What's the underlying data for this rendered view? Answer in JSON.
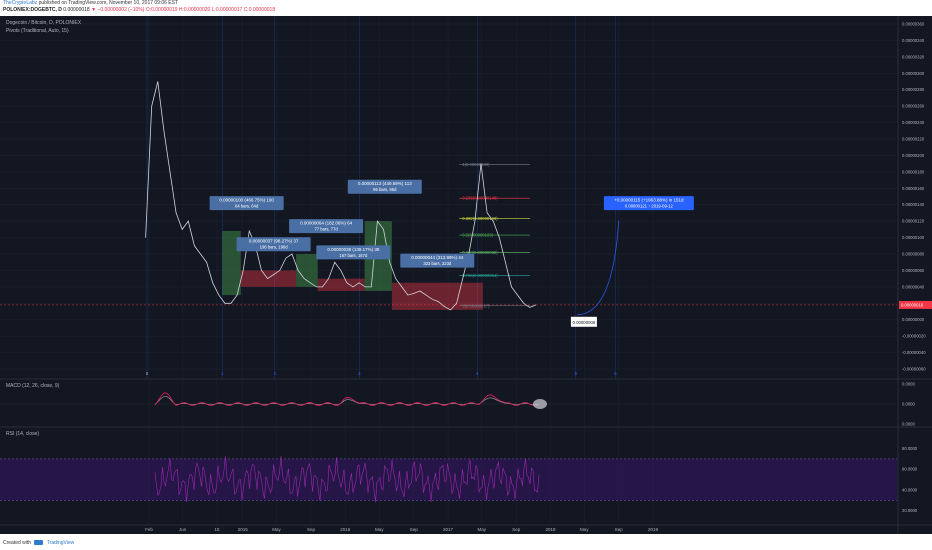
{
  "header": {
    "publisher": "TheCryptoLabz",
    "published_text": "published on TradingView.com, November 10, 2017 09:06 EST",
    "symbol_line": "POLONIEX:DOGEBTC, D",
    "price": "0.00000018",
    "change": "−0.00000002 (−10%)",
    "ohlc": "O:0.00000019 H:0.00000020 L:0.00000017 C:0.00000018"
  },
  "footer": {
    "created_with": "Created with",
    "brand": "TradingView"
  },
  "chart_data": [
    {
      "type": "line",
      "title": "Dogecoin / Bitcoin, D, POLONIEX",
      "subtitle": "Pivots (Traditional, Auto, 15)",
      "x": [
        "Feb",
        "Jun",
        "15",
        "2015",
        "May",
        "Sep",
        "2016",
        "May",
        "Sep",
        "2017",
        "May",
        "Sep",
        "2018",
        "May",
        "Sep",
        "2019"
      ],
      "y_ticks": [
        "0.00000360",
        "0.00000340",
        "0.00000320",
        "0.00000300",
        "0.00000280",
        "0.00000260",
        "0.00000240",
        "0.00000220",
        "0.00000200",
        "0.00000180",
        "0.00000160",
        "0.00000140",
        "0.00000120",
        "0.00000100",
        "0.00000080",
        "0.00000060",
        "0.00000040",
        "0.00000020",
        "0.00000000",
        "-0.00000020",
        "-0.00000040",
        "-0.00000060"
      ],
      "last_price_label": "0.00000018",
      "series": [
        {
          "values": [
            1e-06,
            2.6e-06,
            2.9e-06,
            2.3e-06,
            1.8e-06,
            1.3e-06,
            1.1e-06,
            1.2e-06,
            9e-07,
            8e-07,
            7e-07,
            4.5e-07,
            3e-07,
            2e-07,
            2e-07,
            3e-07,
            6e-07,
            1.08e-06,
            9e-07,
            6e-07,
            5e-07,
            5.5e-07,
            6e-07,
            7.5e-07,
            8e-07,
            6e-07,
            5e-07,
            4.5e-07,
            4e-07,
            4e-07,
            5e-07,
            7e-07,
            6e-07,
            4.5e-07,
            4e-07,
            4.5e-07,
            4e-07,
            4e-07,
            1.2e-06,
            1.1e-06,
            7e-07,
            5e-07,
            4e-07,
            3e-07,
            3.2e-07,
            3.5e-07,
            3e-07,
            2.5e-07,
            2.2e-07,
            1.6e-07,
            1.2e-07,
            2e-07,
            5e-07,
            8e-07,
            1.2e-06,
            1.9e-06,
            1.3e-06,
            1.2e-06,
            1e-06,
            7e-07,
            4e-07,
            3e-07,
            2e-07,
            1.5e-07,
            1.8e-07
          ],
          "start_date": "2014-01-20",
          "end_date": "2017-11-10"
        }
      ],
      "annotations": [
        {
          "label": "0.00000100 (466.75%) 100",
          "sublabel": "64 bars, 64d"
        },
        {
          "label": "0.00000037 (98.27%) 37",
          "sublabel": "196 bars, 196d"
        },
        {
          "label": "0.00000064 (182.06%) 64",
          "sublabel": "77 bars, 77d"
        },
        {
          "label": "0.00000038 (139.17%) 38",
          "sublabel": "167 bars, 167d"
        },
        {
          "label": "0.00000113 (449.69%) 113",
          "sublabel": "96 bars, 96d"
        },
        {
          "label": "0.00000044 (313.99%) 44",
          "sublabel": "323 bars, 323d"
        },
        {
          "label": "+0.00000115 (+1963.88%) in 151d",
          "sublabel": "0.00000121   ↑ 2019-09-12"
        },
        {
          "label": "0.00000006"
        }
      ],
      "fib_levels": [
        {
          "label": "1(0.00000189)",
          "value": 1.89e-06,
          "color": "#787b86"
        },
        {
          "label": "0.236(0.00000148)",
          "value": 1.48e-06,
          "color": "#f23645"
        },
        {
          "label": "0.382(0.00000123)",
          "value": 1.23e-06,
          "color": "#cddc39"
        },
        {
          "label": "0.5(0.00000103)",
          "value": 1.03e-06,
          "color": "#4caf50"
        },
        {
          "label": "0.618(0.00000082)",
          "value": 8.2e-07,
          "color": "#66bb6a"
        },
        {
          "label": "0.786(0.00000054)",
          "value": 5.4e-07,
          "color": "#26a69a"
        },
        {
          "label": "0(0.00000017)",
          "value": 1.7e-07,
          "color": "#787b86"
        }
      ],
      "pivot_markers": [
        "0",
        "1",
        "2",
        "3",
        "4",
        "5",
        "6"
      ]
    },
    {
      "type": "line",
      "title": "MACD (12, 26, close, 9)",
      "y_ticks": [
        "0.0000",
        "0.0000",
        "0.0000"
      ],
      "series": [
        {
          "name": "MACD",
          "color": "#e91e63"
        },
        {
          "name": "Signal",
          "color": "#9e9e9e"
        }
      ]
    },
    {
      "type": "line",
      "title": "RSI (14, close)",
      "y_ticks": [
        "80.0000",
        "60.0000",
        "40.0000",
        "20.0000"
      ],
      "ylim": [
        10,
        95
      ],
      "bands": [
        30,
        70
      ],
      "series": [
        {
          "name": "RSI",
          "color": "#9c27b0"
        }
      ]
    }
  ]
}
